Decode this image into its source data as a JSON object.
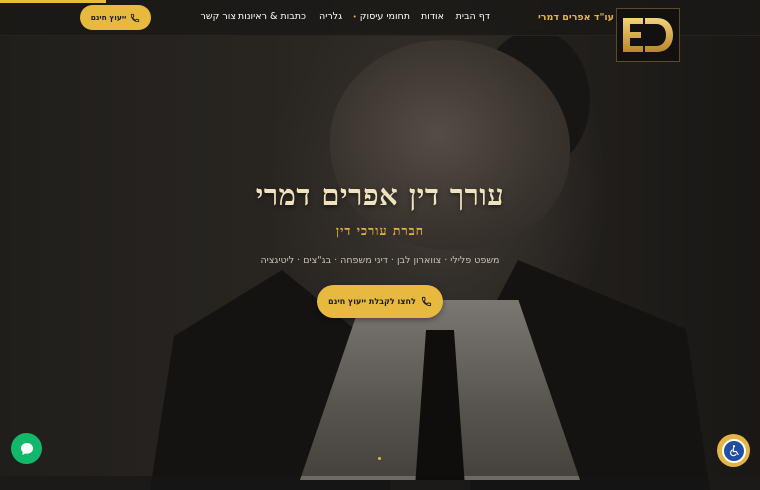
{
  "brand": {
    "logo_text": "ED",
    "name": "עו\"ד אפרים דמרי"
  },
  "nav": {
    "items": [
      {
        "label": "דף הבית"
      },
      {
        "label": "אודות"
      },
      {
        "label": "תחומי עיסוק"
      },
      {
        "label": "גלריה"
      },
      {
        "label": "כתבות & ראיונות"
      },
      {
        "label": "צור קשר"
      }
    ]
  },
  "header_cta": {
    "label": "ייעוץ חינם",
    "icon": "phone-icon"
  },
  "hero": {
    "title": "עורך דין אפרים דמרי",
    "subtitle": "חברת עורכי דין",
    "practice_areas": "משפט פלילי · צווארון לבן · דיני משפחה · בג\"צים · ליטיגציה",
    "cta_label": "לחצו לקבלת ייעוץ חינם",
    "cta_icon": "phone-icon"
  },
  "page_scroll_progress": 0.14,
  "colors": {
    "accent": "#e7ba3f",
    "header_bg": "#1a1816",
    "chat": "#12b86a",
    "accessibility": "#1f4ea3"
  },
  "widgets": {
    "chat_icon": "chat-bubble-icon",
    "accessibility_icon": "wheelchair-icon"
  }
}
